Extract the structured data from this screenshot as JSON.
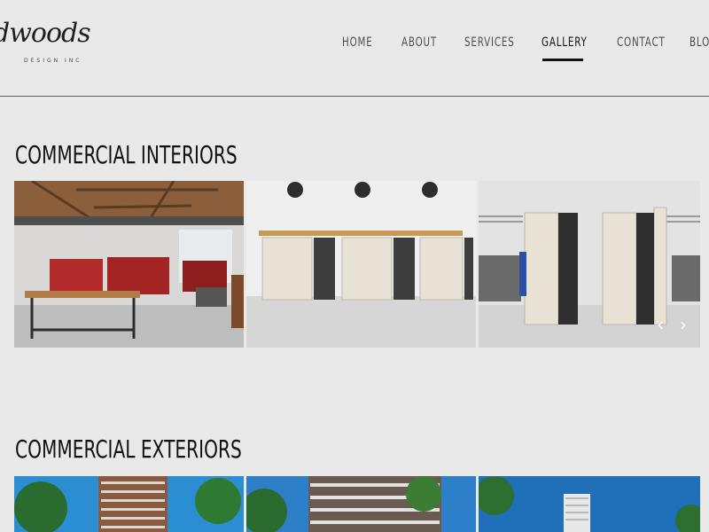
{
  "logo": {
    "script": "dwoods",
    "sub": "DESIGN INC"
  },
  "nav": {
    "items": [
      {
        "label": "HOME"
      },
      {
        "label": "ABOUT"
      },
      {
        "label": "SERVICES"
      },
      {
        "label": "GALLERY",
        "active": true
      },
      {
        "label": "CONTACT"
      },
      {
        "label": "BLOG"
      }
    ]
  },
  "sections": [
    {
      "title": "COMMERCIAL INTERIORS"
    },
    {
      "title": "COMMERCIAL EXTERIORS"
    }
  ],
  "gallery": {
    "prev_icon": "‹",
    "next_icon": "›"
  },
  "colors": {
    "background": "#e9e9ea",
    "text": "#111111",
    "accent_underline": "#111111"
  }
}
